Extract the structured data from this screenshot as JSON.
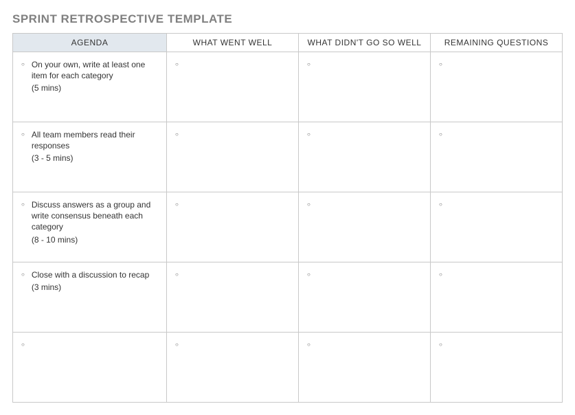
{
  "title": "SPRINT RETROSPECTIVE TEMPLATE",
  "headers": {
    "agenda": "AGENDA",
    "well": "WHAT WENT WELL",
    "notwell": "WHAT DIDN'T GO SO WELL",
    "questions": "REMAINING QUESTIONS"
  },
  "rows": [
    {
      "agenda_text": "On your own, write at least one item for each category",
      "agenda_time": "(5 mins)",
      "well": "",
      "notwell": "",
      "questions": ""
    },
    {
      "agenda_text": "All team members read their responses",
      "agenda_time": "(3 - 5 mins)",
      "well": "",
      "notwell": "",
      "questions": ""
    },
    {
      "agenda_text": "Discuss answers as a group and write consensus beneath each category",
      "agenda_time": "(8 - 10 mins)",
      "well": "",
      "notwell": "",
      "questions": ""
    },
    {
      "agenda_text": "Close with a discussion to recap",
      "agenda_time": "(3 mins)",
      "well": "",
      "notwell": "",
      "questions": ""
    },
    {
      "agenda_text": "",
      "agenda_time": "",
      "well": "",
      "notwell": "",
      "questions": ""
    }
  ]
}
